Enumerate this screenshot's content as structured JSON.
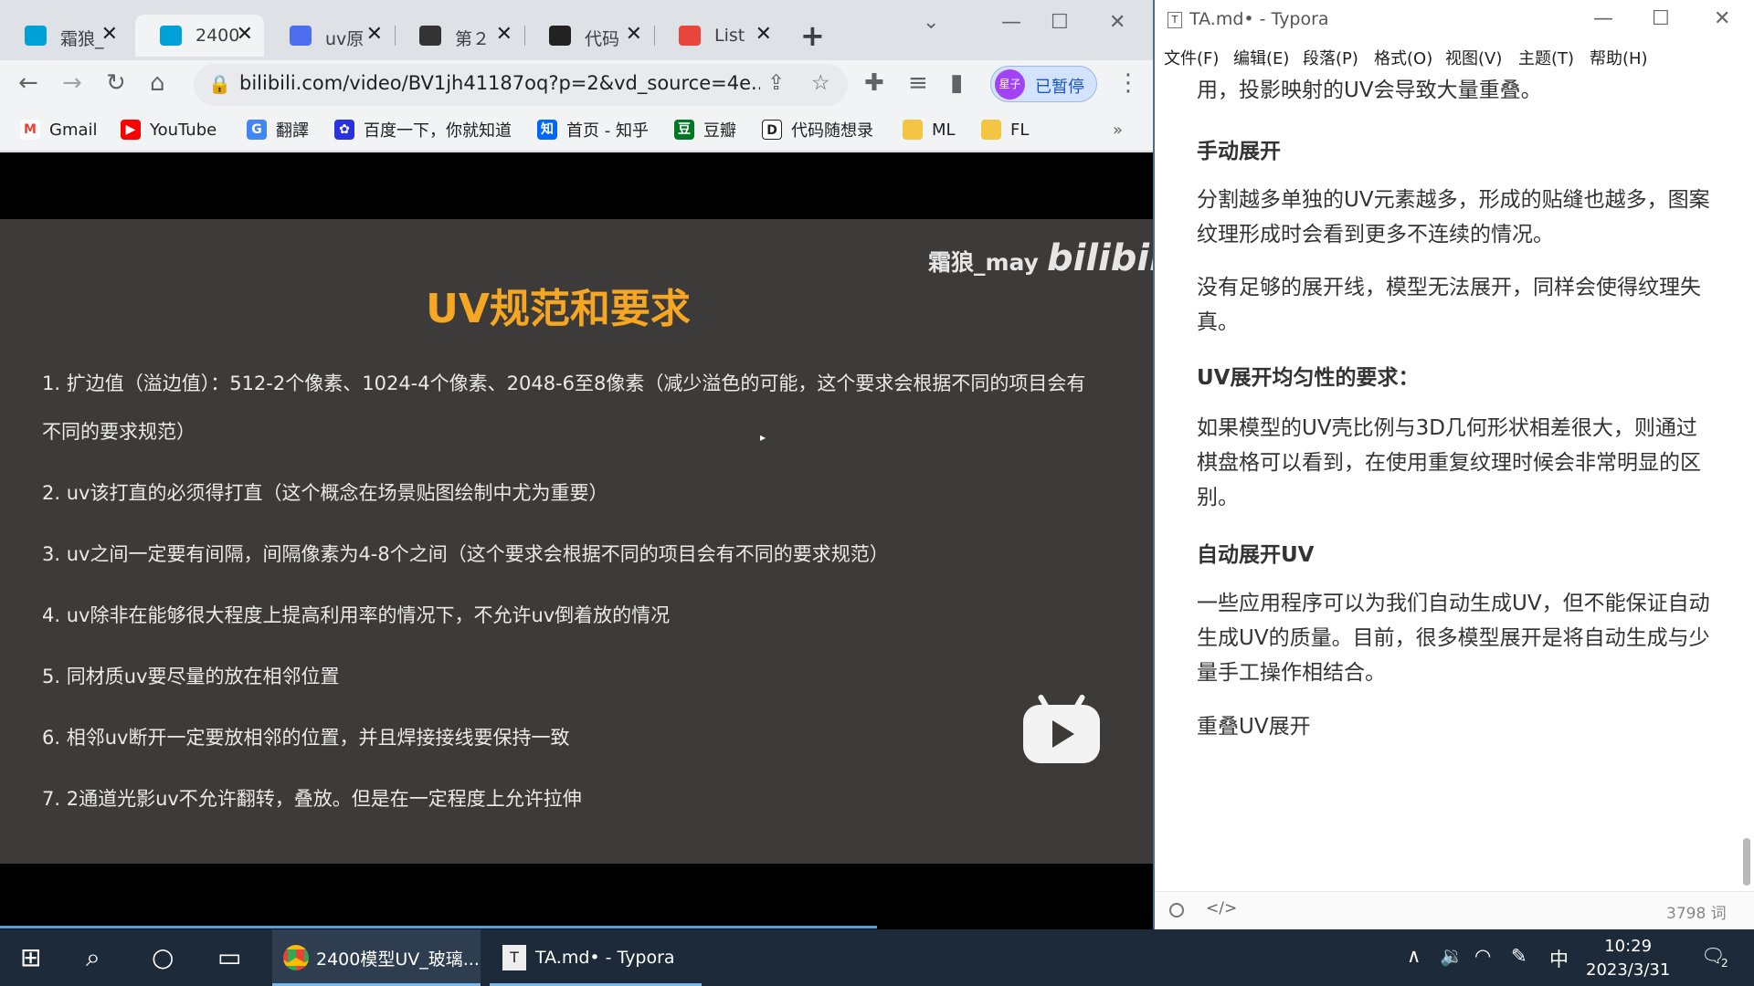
{
  "browser": {
    "tabs": [
      {
        "label": "霜狼_",
        "favicon_color": "#00a1d6",
        "active": false
      },
      {
        "label": "2400",
        "favicon_color": "#00a1d6",
        "active": true
      },
      {
        "label": "uv原",
        "favicon_color": "#4e6ef2",
        "active": false
      },
      {
        "label": "第２",
        "favicon_color": "#333333",
        "active": false
      },
      {
        "label": "代码",
        "favicon_color": "#222222",
        "active": false
      },
      {
        "label": "List",
        "favicon_color": "#e8453c",
        "active": false
      }
    ],
    "new_tab_glyph": "+",
    "url": "bilibili.com/video/BV1jh41187oq?p=2&vd_source=4e...",
    "profile_avatar_text": "星子",
    "profile_status": "已暂停",
    "bookmarks": [
      {
        "label": "Gmail",
        "icon": "gmail-icon",
        "color": "#ea4335",
        "glyph": "M"
      },
      {
        "label": "YouTube",
        "icon": "youtube-icon",
        "color": "#ff0000",
        "glyph": "▶"
      },
      {
        "label": "翻譯",
        "icon": "translate-icon",
        "color": "#4285f4",
        "glyph": "G"
      },
      {
        "label": "百度一下，你就知道",
        "icon": "baidu-icon",
        "color": "#2932e1",
        "glyph": "✿"
      },
      {
        "label": "首页 - 知乎",
        "icon": "zhihu-icon",
        "color": "#0066ff",
        "glyph": "知"
      },
      {
        "label": "豆瓣",
        "icon": "douban-icon",
        "color": "#007722",
        "glyph": "豆"
      },
      {
        "label": "代码随想录",
        "icon": "code-icon",
        "color": "#222222",
        "glyph": "D"
      },
      {
        "label": "ML",
        "icon": "folder-icon",
        "color": "#f4c542",
        "glyph": ""
      },
      {
        "label": "FL",
        "icon": "folder-icon",
        "color": "#f4c542",
        "glyph": ""
      }
    ],
    "bookmarks_overflow": "»"
  },
  "video": {
    "watermark": "霜狼_may",
    "logo": "bilibili",
    "slide_title": "UV规范和要求",
    "rules": [
      "1. 扩边值（溢边值）：512-2个像素、1024-4个像素、2048-6至8像素（减少溢色的可能，这个要求会根据不同的项目会有不同的要求规范）",
      "2. uv该打直的必须得打直（这个概念在场景贴图绘制中尤为重要）",
      "3. uv之间一定要有间隔，间隔像素为4-8个之间（这个要求会根据不同的项目会有不同的要求规范）",
      "4. uv除非在能够很大程度上提高利用率的情况下，不允许uv倒着放的情况",
      "5. 同材质uv要尽量的放在相邻位置",
      "6. 相邻uv断开一定要放相邻的位置，并且焊接接线要保持一致",
      "7. 2通道光影uv不允许翻转，叠放。但是在一定程度上允许拉伸"
    ]
  },
  "typora": {
    "title": "TA.md• - Typora",
    "menu": [
      "文件(F)",
      "编辑(E)",
      "段落(P)",
      "格式(O)",
      "视图(V)",
      "主题(T)",
      "帮助(H)"
    ],
    "content": {
      "p0": "用，投影映射的UV会导致大量重叠。",
      "h1": "手动展开",
      "p1": "分割越多单独的UV元素越多，形成的贴缝也越多，图案纹理形成时会看到更多不连续的情况。",
      "p2": "没有足够的展开线，模型无法展开，同样会使得纹理失真。",
      "h2": "UV展开均匀性的要求：",
      "p3": "如果模型的UV壳比例与3D几何形状相差很大，则通过棋盘格可以看到，在使用重复纹理时候会非常明显的区别。",
      "h3": "自动展开UV",
      "p4": "一些应用程序可以为我们自动生成UV，但不能保证自动生成UV的质量。目前，很多模型展开是将自动生成与少量手工操作相结合。",
      "p5": "重叠UV展开"
    },
    "word_count": "3798 词"
  },
  "taskbar": {
    "apps": [
      {
        "label": "2400模型UV_玻璃...",
        "icon": "chrome-icon"
      },
      {
        "label": "TA.md• - Typora",
        "icon": "typora-icon"
      }
    ],
    "ime": "中",
    "time": "10:29",
    "date": "2023/3/31",
    "notification_count": "2"
  }
}
